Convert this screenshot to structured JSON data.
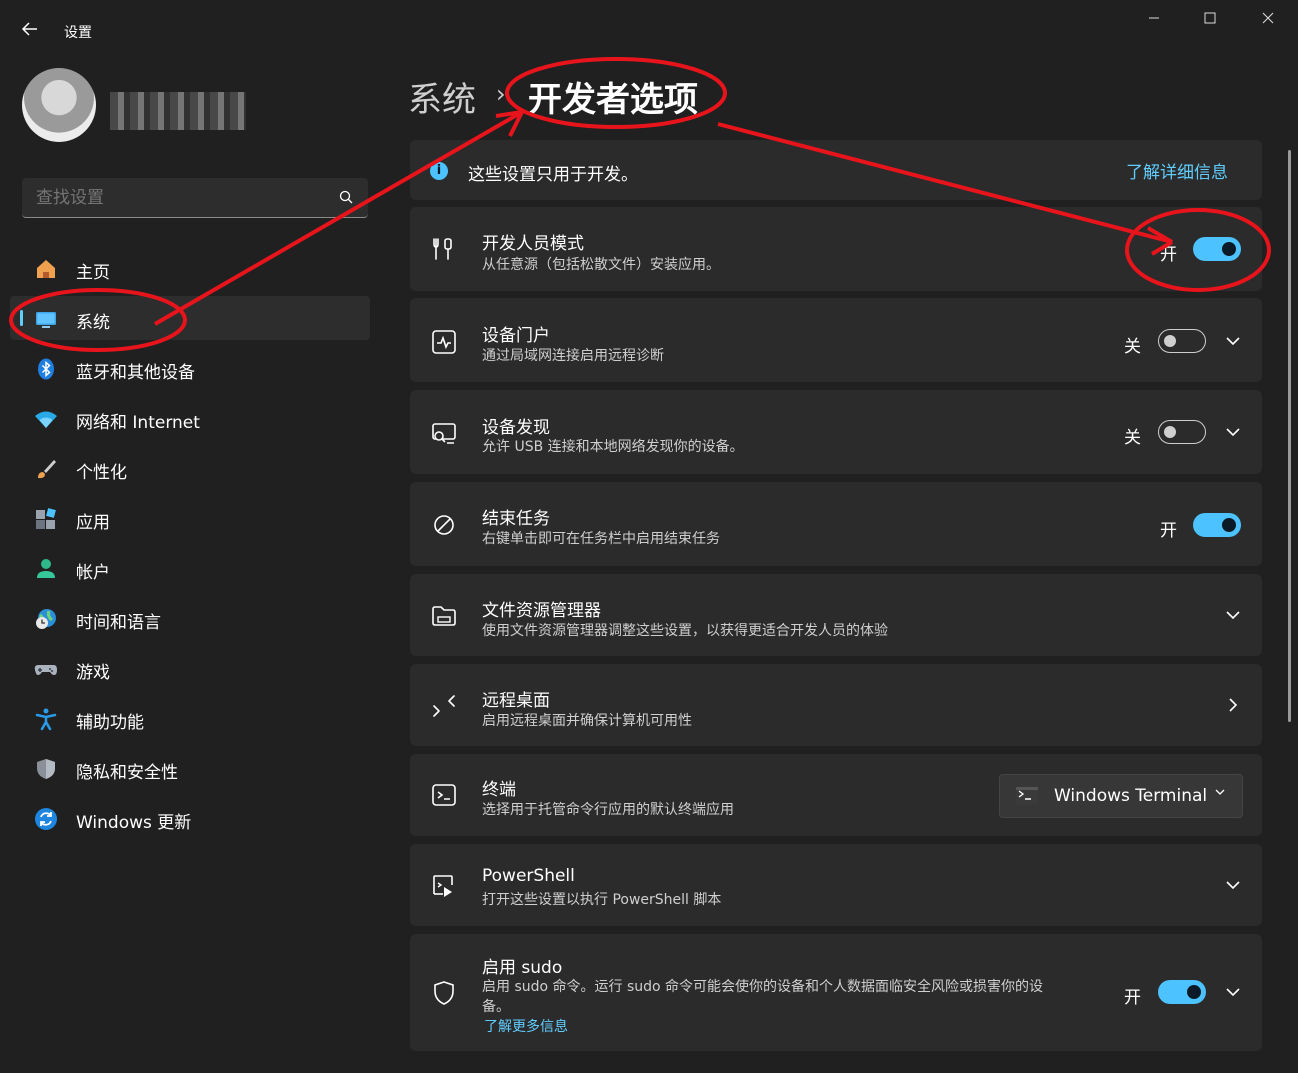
{
  "window": {
    "title": "设置",
    "minimize_icon": "minimize-icon",
    "maximize_icon": "maximize-icon",
    "close_icon": "close-icon"
  },
  "search": {
    "placeholder": "查找设置"
  },
  "sidebar": {
    "items": [
      {
        "label": "主页",
        "icon": "home-icon"
      },
      {
        "label": "系统",
        "icon": "system-icon",
        "active": true
      },
      {
        "label": "蓝牙和其他设备",
        "icon": "bluetooth-icon"
      },
      {
        "label": "网络和 Internet",
        "icon": "wifi-icon"
      },
      {
        "label": "个性化",
        "icon": "brush-icon"
      },
      {
        "label": "应用",
        "icon": "apps-icon"
      },
      {
        "label": "帐户",
        "icon": "account-icon"
      },
      {
        "label": "时间和语言",
        "icon": "globe-clock-icon"
      },
      {
        "label": "游戏",
        "icon": "gamepad-icon"
      },
      {
        "label": "辅助功能",
        "icon": "accessibility-icon"
      },
      {
        "label": "隐私和安全性",
        "icon": "shield-icon"
      },
      {
        "label": "Windows 更新",
        "icon": "update-icon"
      }
    ]
  },
  "breadcrumb": {
    "parent": "系统",
    "separator": "›",
    "current": "开发者选项"
  },
  "info": {
    "text": "这些设置只用于开发。",
    "link": "了解详细信息"
  },
  "settings": {
    "dev_mode": {
      "title": "开发人员模式",
      "desc": "从任意源（包括松散文件）安装应用。",
      "state": "开",
      "on": true
    },
    "device_portal": {
      "title": "设备门户",
      "desc": "通过局域网连接启用远程诊断",
      "state": "关",
      "on": false
    },
    "device_discovery": {
      "title": "设备发现",
      "desc": "允许 USB 连接和本地网络发现你的设备。",
      "state": "关",
      "on": false
    },
    "end_task": {
      "title": "结束任务",
      "desc": "右键单击即可在任务栏中启用结束任务",
      "state": "开",
      "on": true
    },
    "file_explorer": {
      "title": "文件资源管理器",
      "desc": "使用文件资源管理器调整这些设置，以获得更适合开发人员的体验"
    },
    "remote_desktop": {
      "title": "远程桌面",
      "desc": "启用远程桌面并确保计算机可用性"
    },
    "terminal": {
      "title": "终端",
      "desc": "选择用于托管命令行应用的默认终端应用",
      "selected": "Windows Terminal"
    },
    "powershell": {
      "title": "PowerShell",
      "desc": "打开这些设置以执行 PowerShell 脚本"
    },
    "sudo": {
      "title": "启用 sudo",
      "desc_line1": "启用 sudo 命令。运行 sudo 命令可能会使你的设备和个人数据面临安全风险或损害你的设",
      "desc_line2": "备。",
      "link": "了解更多信息",
      "state": "开",
      "on": true
    }
  },
  "colors": {
    "accent": "#4cc2ff",
    "annotation": "#e8141c",
    "background": "#202020",
    "card": "#2b2b2b"
  }
}
